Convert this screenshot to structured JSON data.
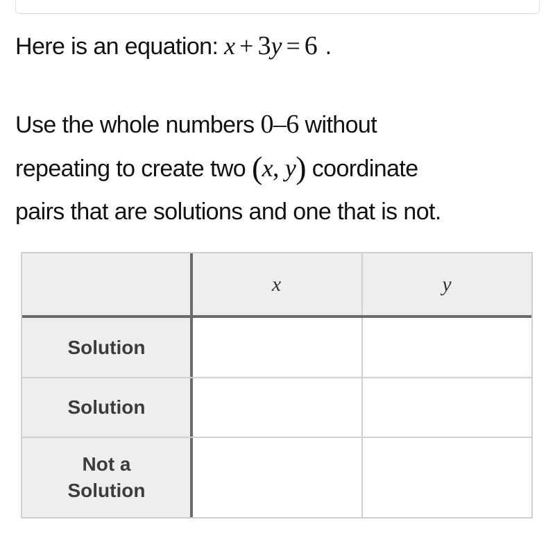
{
  "top_box": {
    "label": ""
  },
  "prompt": {
    "intro_text": "Here is an equation:",
    "equation": {
      "lhs_var1": "x",
      "plus": "+",
      "coef": "3",
      "lhs_var2": "y",
      "equals": "=",
      "rhs": "6",
      "period": "."
    },
    "line1_pre": "Use the whole numbers",
    "range_start": "0",
    "range_dash": "–",
    "range_end": "6",
    "line1_post": "without",
    "line2_pre": "repeating to create two",
    "paren_open": "(",
    "pair_x": "x",
    "pair_comma": ",",
    "pair_y": "y",
    "paren_close": ")",
    "line2_post": "coordinate",
    "line3": "pairs that are solutions and one that is not."
  },
  "table": {
    "columns": [
      "",
      "x",
      "y"
    ],
    "rows": [
      {
        "label": "Solution",
        "x": "",
        "y": ""
      },
      {
        "label": "Solution",
        "x": "",
        "y": ""
      },
      {
        "label_line1": "Not a",
        "label_line2": "Solution",
        "x": "",
        "y": ""
      }
    ]
  }
}
